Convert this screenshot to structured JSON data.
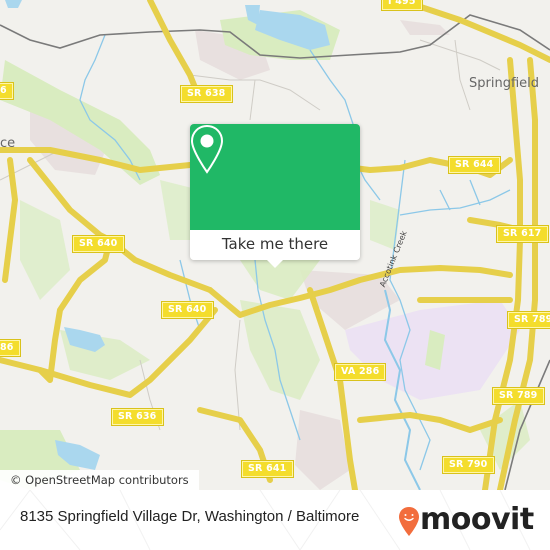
{
  "map": {
    "place_labels": {
      "springfield": "Springfield",
      "left_edge_partial": "ce"
    },
    "waterway_labels": {
      "accotink_creek": "Accotink Creek"
    },
    "road_shields": {
      "i495_partial": "I 495",
      "sr638": "SR 638",
      "sr644": "SR 644",
      "sr640_a": "SR 640",
      "sr640_b": "SR 640",
      "sr617": "SR 617",
      "sr789_a": "SR 789",
      "sr789_b": "SR 789",
      "va286": "VA 286",
      "sr636": "SR 636",
      "sr636_partial": "86",
      "sr641": "SR 641",
      "sr790": "SR 790",
      "sr6_partial_left": "6"
    },
    "attribution": "© OpenStreetMap contributors",
    "colors": {
      "land": "#f2f1ed",
      "park": "#d9ecc0",
      "water": "#aad7ee",
      "road": "#f7e46a",
      "industrial": "#ece2f3",
      "urban": "#e8e0df",
      "rail": "#777777"
    }
  },
  "popup": {
    "icon": "location-pin-icon",
    "action_label": "Take me there",
    "color": "#20b866"
  },
  "footer": {
    "address": "8135 Springfield Village Dr, Washington / Baltimore",
    "brand_name": "moovit",
    "brand_icon": "moovit-logo-pin-icon",
    "brand_color": "#f26d3d"
  }
}
